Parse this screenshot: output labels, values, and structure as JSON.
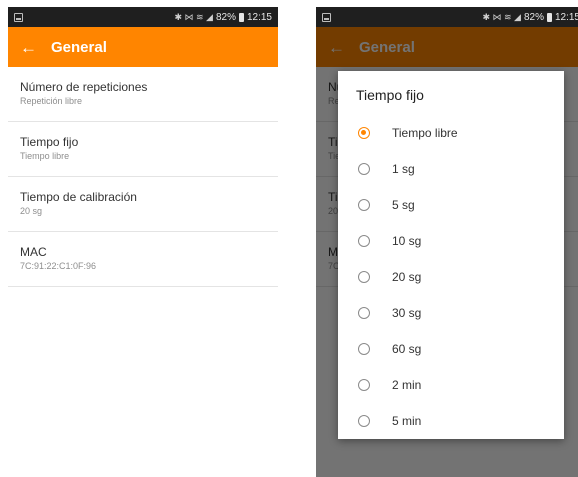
{
  "status_bar": {
    "icons": "✱ ⋈ ≋ ◢",
    "battery": "82%",
    "time": "12:15"
  },
  "colors": {
    "accent": "#ff8500",
    "status_bar": "#1f1f1f"
  },
  "appbar": {
    "back_icon": "←",
    "title": "General"
  },
  "settings": {
    "items": [
      {
        "title": "Número de repeticiones",
        "subtitle": "Repetición libre"
      },
      {
        "title": "Tiempo fijo",
        "subtitle": "Tiempo libre"
      },
      {
        "title": "Tiempo de calibración",
        "subtitle": "20 sg"
      },
      {
        "title": "MAC",
        "subtitle": "7C:91:22:C1:0F:96"
      }
    ]
  },
  "dialog": {
    "title": "Tiempo fijo",
    "selected_index": 0,
    "options": [
      "Tiempo libre",
      "1 sg",
      "5 sg",
      "10 sg",
      "20 sg",
      "30 sg",
      "60 sg",
      "2 min",
      "5 min"
    ]
  }
}
